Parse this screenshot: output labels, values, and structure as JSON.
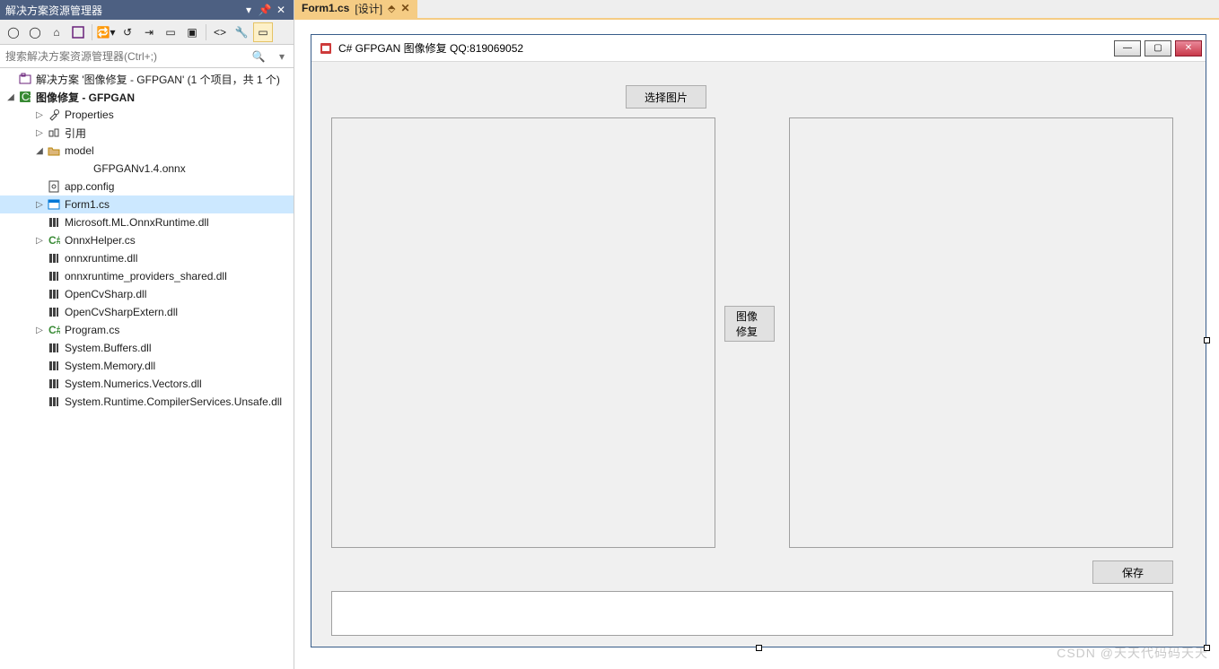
{
  "solution_explorer": {
    "title": "解决方案资源管理器",
    "search_placeholder": "搜索解决方案资源管理器(Ctrl+;)",
    "solution_label": "解决方案 '图像修复 - GFPGAN' (1 个项目，共 1 个)",
    "project_label": "图像修复 - GFPGAN",
    "tree": [
      {
        "level": 2,
        "expander": "▷",
        "icon": "wrench",
        "label": "Properties"
      },
      {
        "level": 2,
        "expander": "▷",
        "icon": "ref",
        "label": "引用"
      },
      {
        "level": 2,
        "expander": "◢",
        "icon": "folder",
        "label": "model"
      },
      {
        "level": 4,
        "expander": "",
        "icon": "none",
        "label": "GFPGANv1.4.onnx"
      },
      {
        "level": 2,
        "expander": "",
        "icon": "config",
        "label": "app.config"
      },
      {
        "level": 2,
        "expander": "▷",
        "icon": "form",
        "label": "Form1.cs",
        "selected": true
      },
      {
        "level": 2,
        "expander": "",
        "icon": "dll",
        "label": "Microsoft.ML.OnnxRuntime.dll"
      },
      {
        "level": 2,
        "expander": "▷",
        "icon": "cs",
        "label": "OnnxHelper.cs"
      },
      {
        "level": 2,
        "expander": "",
        "icon": "dll",
        "label": "onnxruntime.dll"
      },
      {
        "level": 2,
        "expander": "",
        "icon": "dll",
        "label": "onnxruntime_providers_shared.dll"
      },
      {
        "level": 2,
        "expander": "",
        "icon": "dll",
        "label": "OpenCvSharp.dll"
      },
      {
        "level": 2,
        "expander": "",
        "icon": "dll",
        "label": "OpenCvSharpExtern.dll"
      },
      {
        "level": 2,
        "expander": "▷",
        "icon": "cs",
        "label": "Program.cs"
      },
      {
        "level": 2,
        "expander": "",
        "icon": "dll",
        "label": "System.Buffers.dll"
      },
      {
        "level": 2,
        "expander": "",
        "icon": "dll",
        "label": "System.Memory.dll"
      },
      {
        "level": 2,
        "expander": "",
        "icon": "dll",
        "label": "System.Numerics.Vectors.dll"
      },
      {
        "level": 2,
        "expander": "",
        "icon": "dll",
        "label": "System.Runtime.CompilerServices.Unsafe.dll"
      }
    ]
  },
  "tab": {
    "label": "Form1.cs",
    "suffix": "[设计]"
  },
  "form": {
    "title": "C# GFPGAN 图像修复 QQ:819069052",
    "btn_select": "选择图片",
    "btn_repair": "图像修复",
    "btn_save": "保存"
  },
  "watermark": "CSDN @天天代码码天天"
}
